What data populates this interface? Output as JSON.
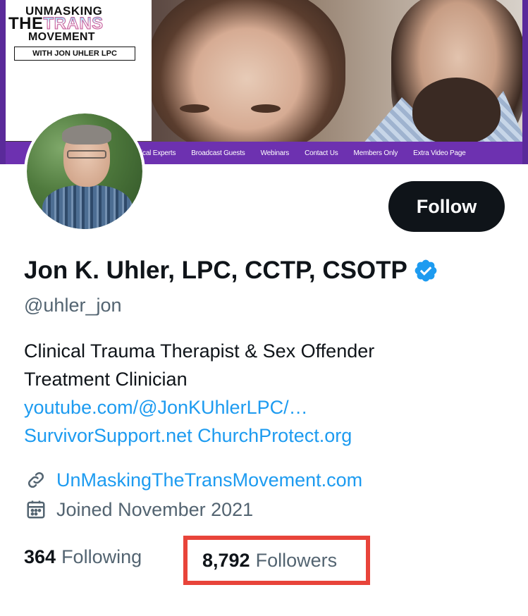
{
  "banner": {
    "logo": {
      "line1": "UNMASKING",
      "line2_a": "THE",
      "line2_b": "TRANS",
      "line3": "MOVEMENT",
      "with": "WITH JON UHLER LPC"
    },
    "nav": [
      "ical Experts",
      "Broadcast Guests",
      "Webinars",
      "Contact Us",
      "Members Only",
      "Extra Video Page"
    ]
  },
  "profile": {
    "follow_label": "Follow",
    "display_name": "Jon K. Uhler, LPC, CCTP, CSOTP",
    "verified_icon": "verified-badge-icon",
    "handle": "@uhler_jon",
    "bio_line1": "Clinical Trauma Therapist & Sex Offender",
    "bio_line2": "Treatment Clinician",
    "bio_link1": "youtube.com/@JonKUhlerLPC/…",
    "bio_link2": "SurvivorSupport.net",
    "bio_link3": "ChurchProtect.org",
    "website": "UnMaskingTheTransMovement.com",
    "joined": "Joined November 2021",
    "following_count": "364",
    "following_label": "Following",
    "followers_count": "8,792",
    "followers_label": "Followers"
  },
  "colors": {
    "link": "#1d9bf0",
    "verified": "#1d9bf0",
    "highlight_box": "#e8443a",
    "banner_nav": "#6d31b0"
  }
}
